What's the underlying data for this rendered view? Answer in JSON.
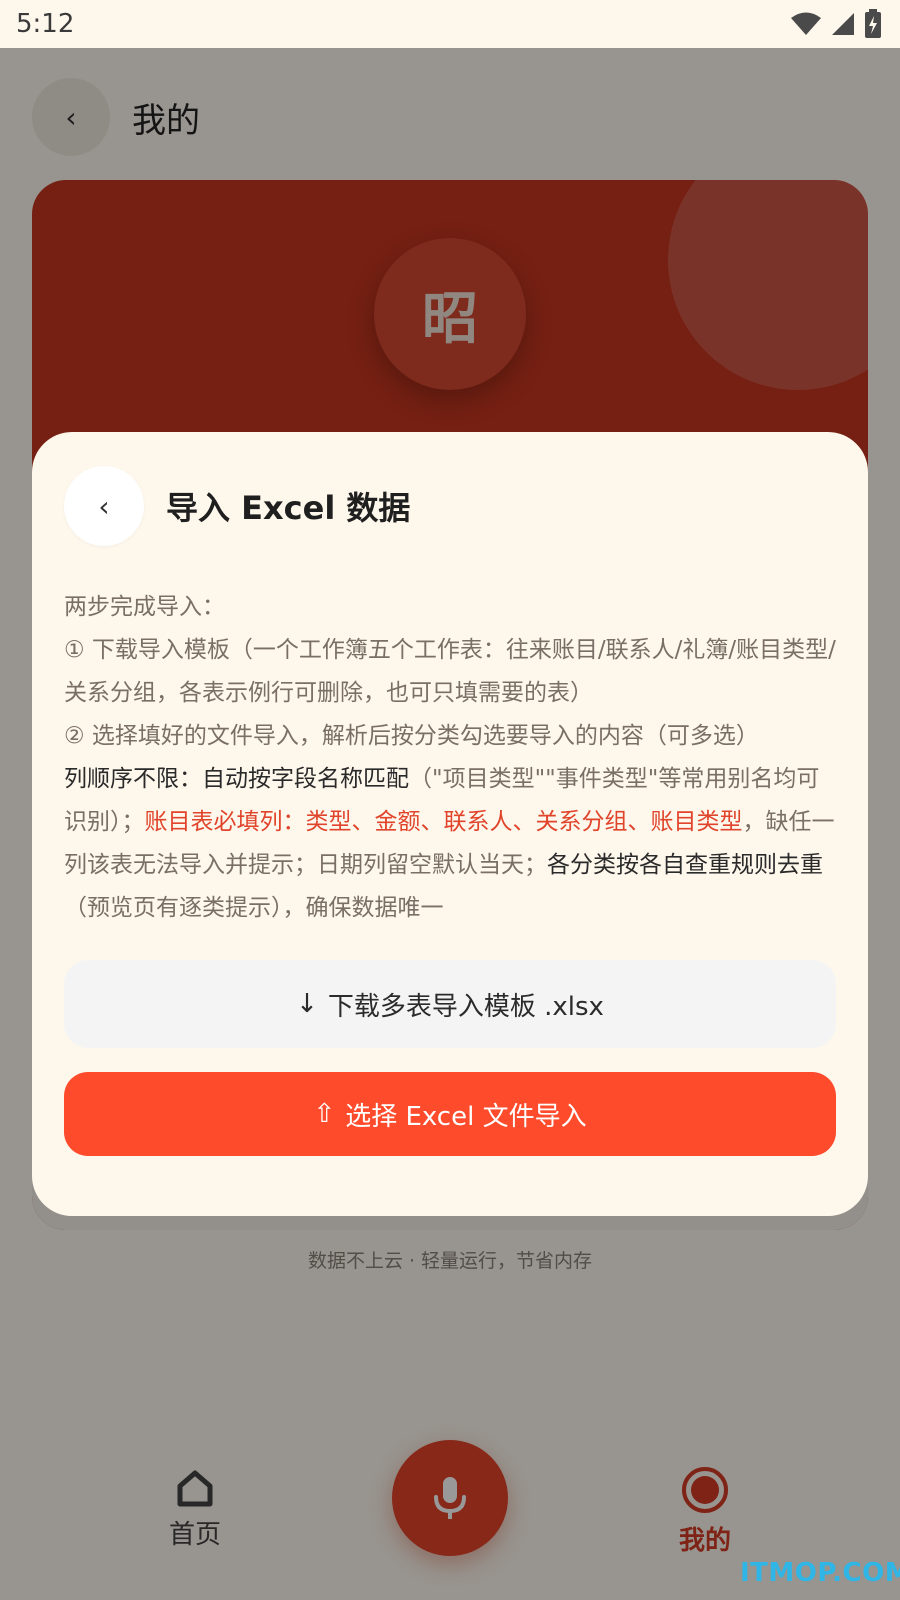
{
  "status_bar": {
    "time": "5:12"
  },
  "page": {
    "title": "我的",
    "avatar_text": "昭",
    "footer_note": "数据不上云 · 轻量运行，节省内存"
  },
  "bottom_nav": {
    "home_label": "首页",
    "mine_label": "我的"
  },
  "modal": {
    "title": "导入 Excel 数据",
    "intro": "两步完成导入：",
    "step1": "① 下载导入模板（一个工作簿五个工作表：往来账目/联系人/礼簿/账目类型/关系分组，各表示例行可删除，也可只填需要的表）",
    "step2": "② 选择填好的文件导入，解析后按分类勾选要导入的内容（可多选）",
    "rule_dark_1": "列顺序不限：自动按字段名称匹配",
    "rule_gray_1": "（\"项目类型\"\"事件类型\"等常用别名均可识别）；",
    "rule_red": "账目表必填列：类型、金额、联系人、关系分组、账目类型",
    "rule_comma": "，",
    "rule_gray_2": "缺任一列该表无法导入并提示；日期列留空默认当天；",
    "rule_dark_2": "各分类按各自查重规则去重",
    "rule_gray_3": "（预览页有逐类提示），确保数据唯一",
    "download_button": "下载多表导入模板 .xlsx",
    "download_icon": "↓",
    "import_button": "选择 Excel 文件导入",
    "import_icon": "⇧"
  },
  "watermark": "ITMOP.COM",
  "colors": {
    "accent": "#fe4b2c",
    "card_red": "#c3361f",
    "modal_bg": "#fef7ec",
    "rule_red": "#e0442b"
  }
}
